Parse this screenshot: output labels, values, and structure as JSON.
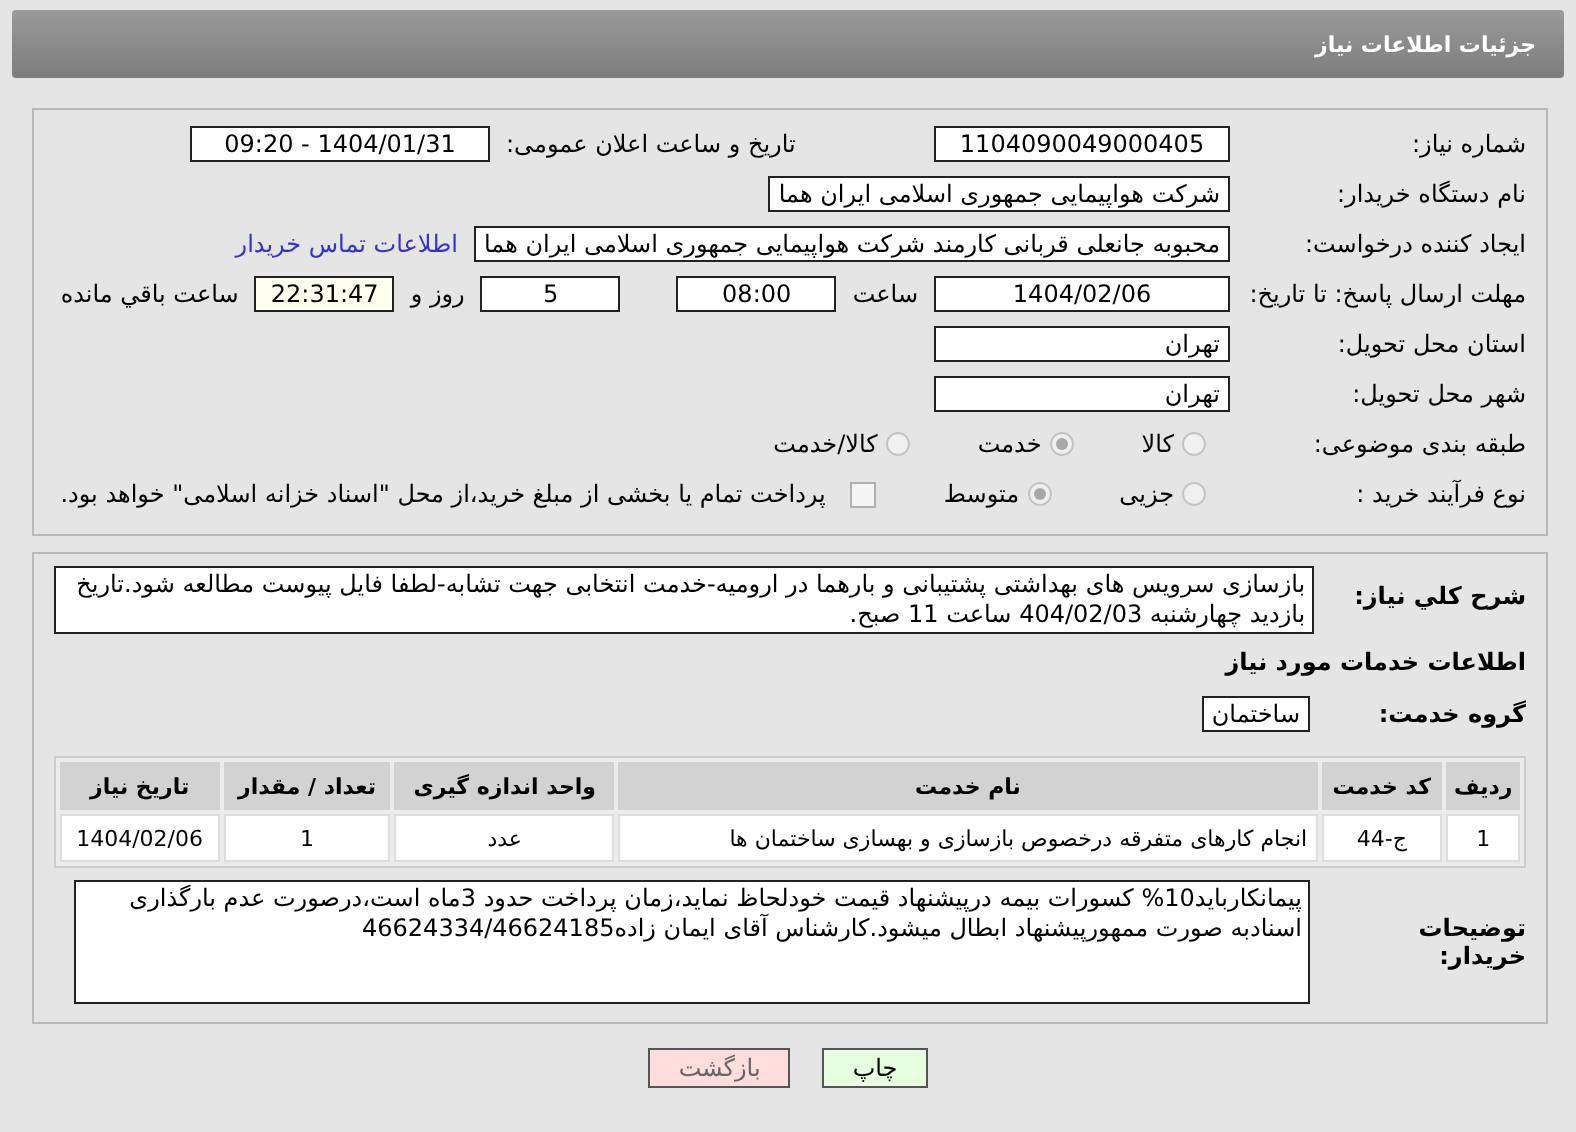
{
  "header": {
    "title": "جزئیات اطلاعات نیاز"
  },
  "details": {
    "need_number": {
      "label": "شماره نیاز:",
      "value": "1104090049000405"
    },
    "announce": {
      "label": "تاریخ و ساعت اعلان عمومی:",
      "value": "1404/01/31 - 09:20"
    },
    "buyer": {
      "label": "نام دستگاه خریدار:",
      "value": "شرکت هواپیمایی جمهوری اسلامی ایران هما"
    },
    "creator": {
      "label": "ایجاد کننده درخواست:",
      "value": "محبوبه جانعلی قربانی کارمند شرکت هواپیمایی جمهوری اسلامی ایران هما",
      "link": "اطلاعات تماس خریدار"
    },
    "deadline": {
      "label": "مهلت ارسال پاسخ: تا تاریخ:",
      "date": "1404/02/06",
      "time_label": "ساعت",
      "time": "08:00",
      "days": "5",
      "days_label": "روز و",
      "remaining": "22:31:47",
      "remaining_label": "ساعت باقي مانده"
    },
    "province": {
      "label": "استان محل تحویل:",
      "value": "تهران"
    },
    "city": {
      "label": "شهر محل تحویل:",
      "value": "تهران"
    },
    "category": {
      "label": "طبقه بندی موضوعی:",
      "options": [
        {
          "label": "کالا",
          "selected": false
        },
        {
          "label": "خدمت",
          "selected": true
        },
        {
          "label": "کالا/خدمت",
          "selected": false
        }
      ]
    },
    "purchase_type": {
      "label": "نوع فرآیند خرید :",
      "options": [
        {
          "label": "جزیی",
          "selected": false
        },
        {
          "label": "متوسط",
          "selected": true
        }
      ],
      "payment": {
        "checked": false,
        "text": "پرداخت تمام یا بخشی از مبلغ خرید،از محل \"اسناد خزانه اسلامی\" خواهد بود."
      }
    }
  },
  "services": {
    "description": {
      "label": "شرح کلي نياز:",
      "value": "بازسازی سرویس های بهداشتی پشتیبانی و بارهما در ارومیه-خدمت انتخابی جهت تشابه-لطفا فایل پیوست مطالعه شود.تاریخ بازدید چهارشنبه 404/02/03 ساعت 11 صبح."
    },
    "section_title": "اطلاعات خدمات مورد نیاز",
    "group": {
      "label": "گروه خدمت:",
      "value": "ساختمان"
    },
    "table": {
      "columns": [
        "ردیف",
        "کد خدمت",
        "نام خدمت",
        "واحد اندازه گیری",
        "تعداد / مقدار",
        "تاریخ نیاز"
      ],
      "rows": [
        [
          "1",
          "ج-44",
          "انجام کارهای متفرقه درخصوص بازسازی و بهسازی ساختمان ها",
          "عدد",
          "1",
          "1404/02/06"
        ]
      ]
    },
    "notes": {
      "label": "توضیحات خریدار:",
      "value": "پیمانکاربايد10% کسورات بیمه درپیشنهاد قیمت خودلحاظ نماید،زمان پرداخت حدود 3ماه است،درصورت عدم بارگذاری اسنادبه صورت ممهورپیشنهاد ابطال میشود.کارشناس آقای ایمان زاده46624334/46624185"
    }
  },
  "buttons": [
    {
      "label": "چاپ",
      "kind": "print"
    },
    {
      "label": "بازگشت",
      "kind": "back"
    }
  ]
}
